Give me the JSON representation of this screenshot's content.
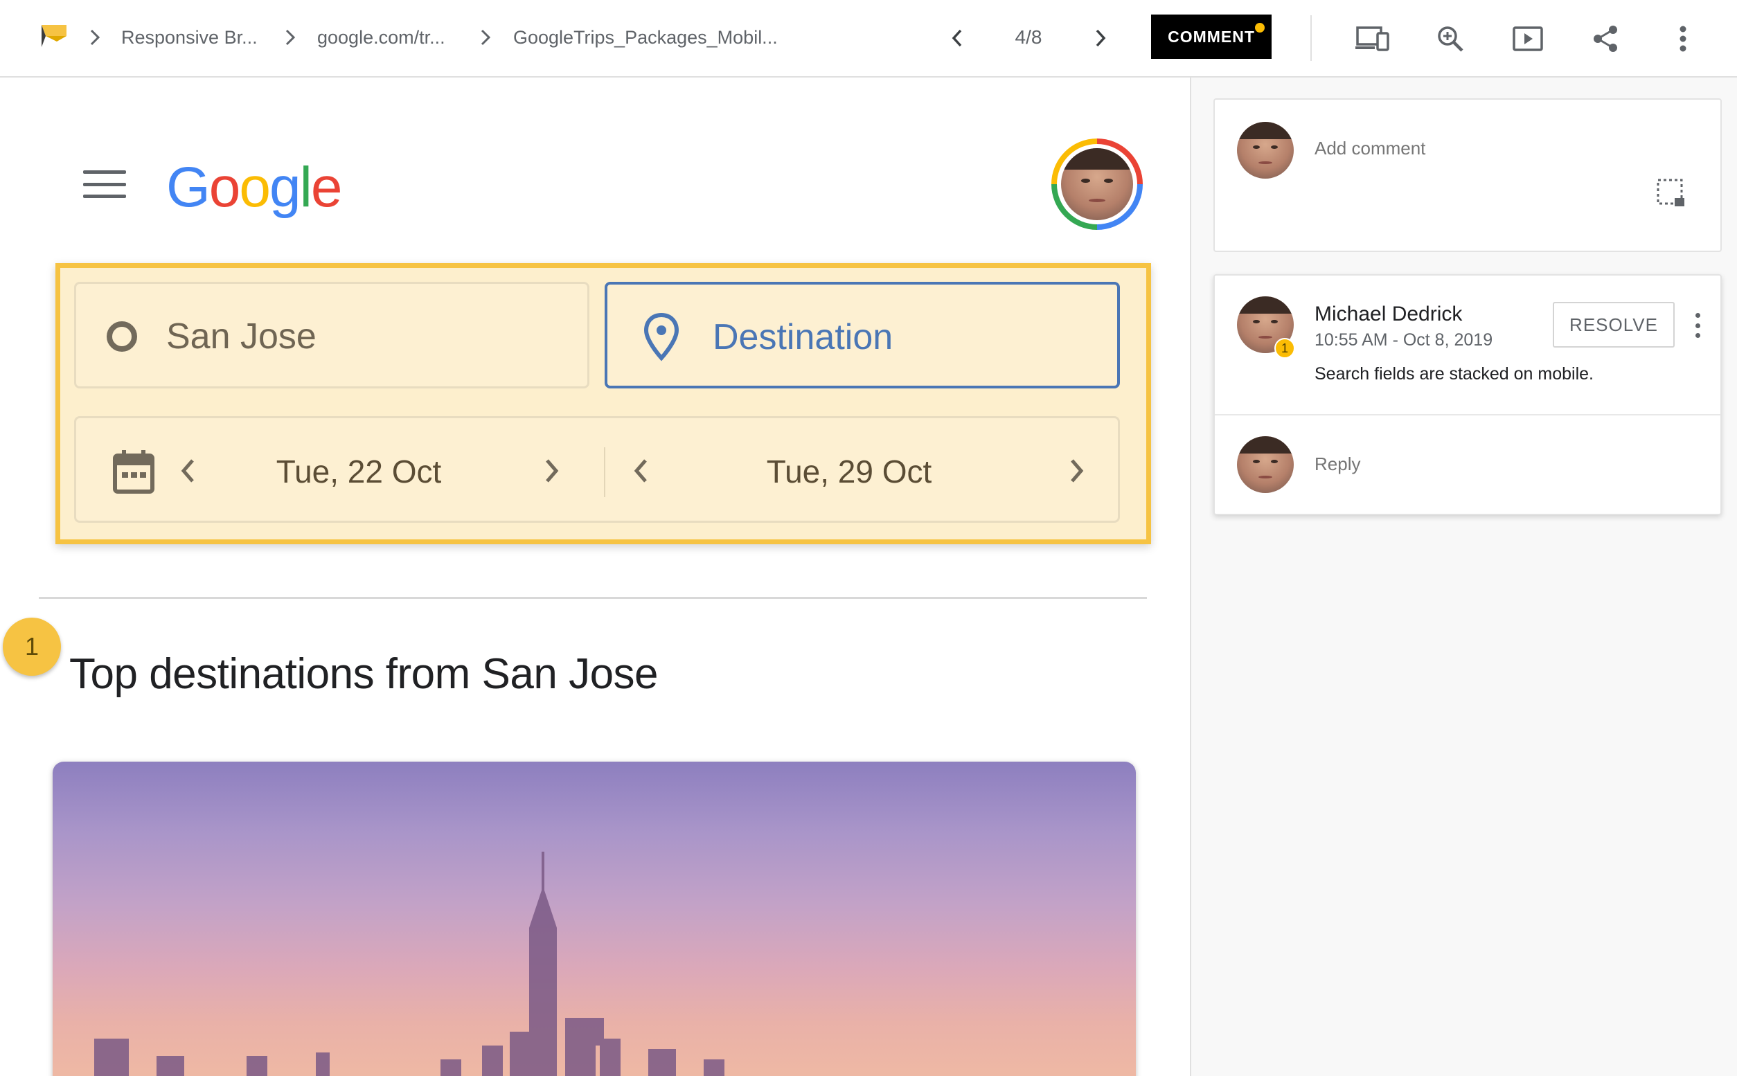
{
  "topbar": {
    "breadcrumbs": [
      "Responsive Br...",
      "google.com/tr...",
      "GoogleTrips_Packages_Mobil..."
    ],
    "page_indicator": "4/8",
    "comment_label": "COMMENT",
    "icons": [
      "logo-flag-icon",
      "chevron-right-icon",
      "chevron-left-icon",
      "devices-icon",
      "zoom-in-icon",
      "present-icon",
      "share-icon",
      "more-vert-icon"
    ]
  },
  "preview": {
    "logo_text": [
      "G",
      "o",
      "o",
      "g",
      "l",
      "e"
    ],
    "logo_colors": [
      "#4285f4",
      "#ea4335",
      "#fbbc04",
      "#4285f4",
      "#34a853",
      "#ea4335"
    ],
    "origin": "San Jose",
    "destination_placeholder": "Destination",
    "depart_date": "Tue, 22 Oct",
    "return_date": "Tue, 29 Oct",
    "pin_number": "1",
    "section_title": "Top destinations from San Jose"
  },
  "sidebar": {
    "add_comment_placeholder": "Add comment",
    "thread": {
      "author": "Michael Dedrick",
      "timestamp": "10:55 AM - Oct 8, 2019",
      "badge": "1",
      "body": "Search fields are stacked on mobile.",
      "resolve_label": "RESOLVE",
      "reply_placeholder": "Reply"
    }
  },
  "colors": {
    "accent_yellow": "#f6c343",
    "highlight_fill": "#fdefcd",
    "destination_blue": "#4a76b5"
  }
}
